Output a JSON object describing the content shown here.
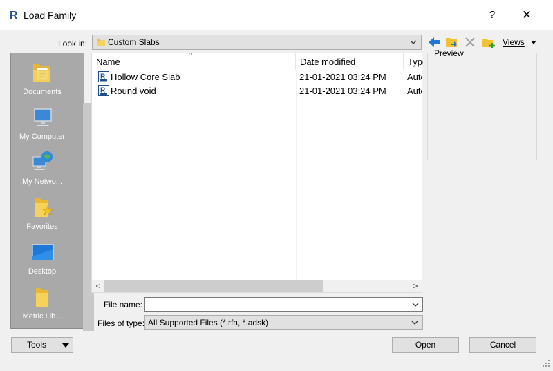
{
  "window": {
    "title": "Load Family",
    "help_glyph": "?",
    "close_glyph": "✕"
  },
  "look_in": {
    "label": "Look in:",
    "value": "Custom Slabs"
  },
  "toolbar": {
    "views_label": "Views"
  },
  "places": [
    {
      "label": "Documents",
      "icon": "documents-folder-icon"
    },
    {
      "label": "My Computer",
      "icon": "computer-icon"
    },
    {
      "label": "My Netwo...",
      "icon": "network-icon"
    },
    {
      "label": "Favorites",
      "icon": "favorites-folder-icon"
    },
    {
      "label": "Desktop",
      "icon": "desktop-icon"
    },
    {
      "label": "Metric Lib...",
      "icon": "folder-icon"
    }
  ],
  "file_list": {
    "columns": [
      "Name",
      "Date modified",
      "Type"
    ],
    "rows": [
      {
        "name": "Hollow Core Slab",
        "date": "21-01-2021 03:24 PM",
        "type": "Auto"
      },
      {
        "name": "Round void",
        "date": "21-01-2021 03:24 PM",
        "type": "Auto"
      }
    ]
  },
  "preview": {
    "label": "Preview"
  },
  "file_name": {
    "label": "File name:",
    "value": ""
  },
  "file_type": {
    "label": "Files of type:",
    "value": "All Supported Files  (*.rfa, *.adsk)"
  },
  "buttons": {
    "tools": "Tools",
    "open": "Open",
    "cancel": "Cancel"
  },
  "colors": {
    "places_bg": "#a9a9a9",
    "accent_blue": "#1e78d7",
    "folder_yellow": "#f2c230"
  }
}
